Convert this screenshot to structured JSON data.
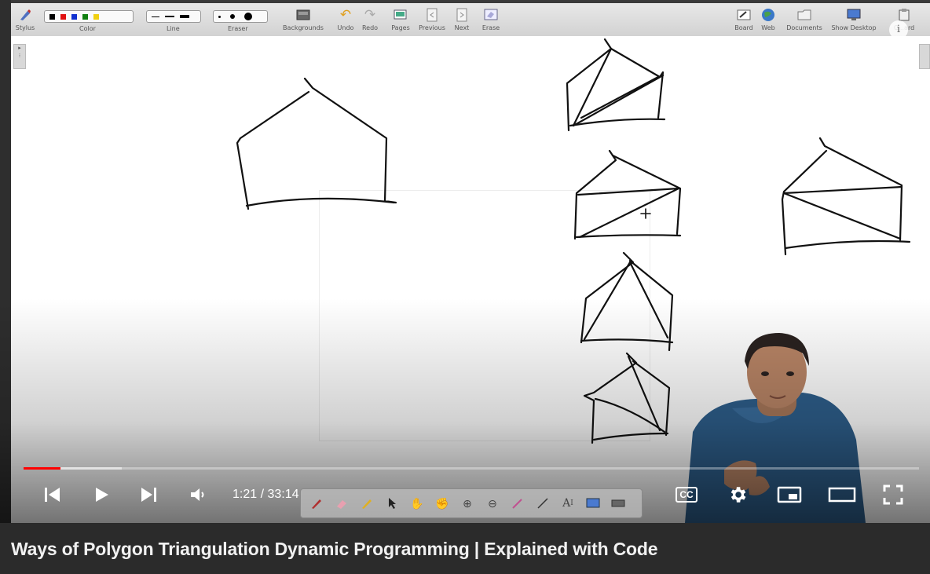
{
  "toolbar": {
    "stylus": "Stylus",
    "color": "Color",
    "line": "Line",
    "eraser": "Eraser",
    "backgrounds": "Backgrounds",
    "undo": "Undo",
    "redo": "Redo",
    "pages": "Pages",
    "previous": "Previous",
    "next": "Next",
    "erase": "Erase",
    "board": "Board",
    "web": "Web",
    "documents": "Documents",
    "show_desktop": "Show Desktop",
    "clipboard": "C...ard",
    "palette_colors": [
      "#000000",
      "#e01010",
      "#1030d0",
      "#108010",
      "#f0d010"
    ]
  },
  "player": {
    "current_time": "1:21",
    "duration": "33:14",
    "time_display": "1:21 / 33:14",
    "progress_fraction": 0.041,
    "buffer_fraction": 0.11,
    "cc_label": "CC",
    "accent_color": "#ff0000"
  },
  "video_title": "Ways of Polygon Triangulation Dynamic Programming | Explained with Code",
  "icons": [
    "stylus-icon",
    "backgrounds-icon",
    "undo-icon",
    "redo-icon",
    "pages-icon",
    "previous-icon",
    "next-icon",
    "erase-icon",
    "board-icon",
    "web-icon",
    "documents-icon",
    "show-desktop-icon",
    "skip-back-icon",
    "play-icon",
    "skip-next-icon",
    "volume-icon",
    "cc-icon",
    "settings-icon",
    "miniplayer-icon",
    "theater-icon",
    "fullscreen-icon",
    "info-icon"
  ]
}
